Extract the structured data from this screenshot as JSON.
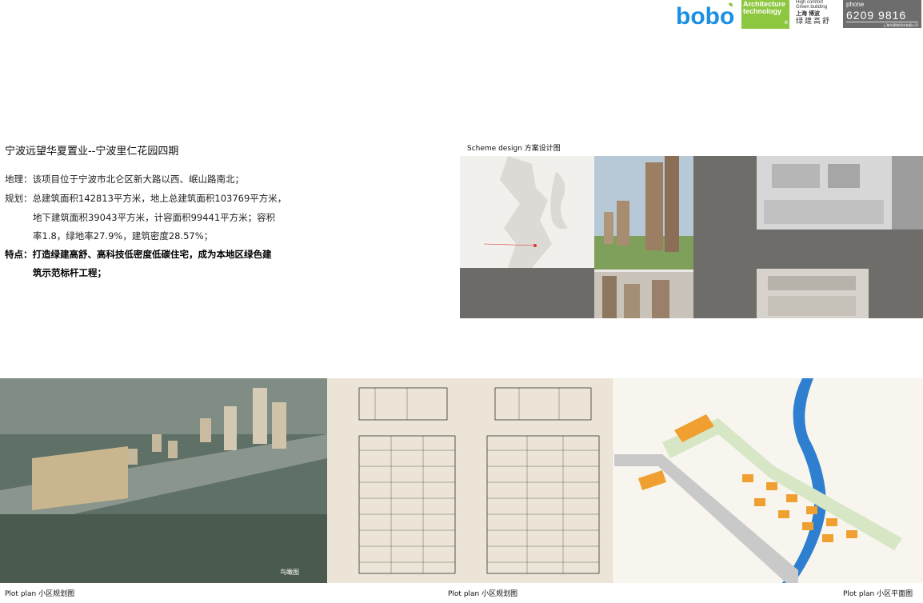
{
  "header": {
    "logo_text": "bobo",
    "arch_line1": "Architecture",
    "arch_line2": "technology",
    "arch_reg": "®",
    "brand_line1": "High comfort",
    "brand_line2": "Green building",
    "brand_cn1": "上海 博波",
    "brand_cn2": "绿建高舒",
    "phone_label": "phone",
    "phone_number": "6209 9816",
    "phone_sub": "上海市建筑科技有限公司"
  },
  "project": {
    "title": "宁波远望华夏置业--宁波里仁花园四期",
    "lines": [
      "地理：该项目位于宁波市北仑区新大路以西、岷山路南北；",
      "规划：总建筑面积142813平方米，地上总建筑面积103769平方米，",
      "地下建筑面积39043平方米，计容面积99441平方米；容积",
      "率1.8，绿地率27.9%，建筑密度28.57%；",
      "特点：打造绿建高舒、高科技低密度低碳住宅，成为本地区绿色建",
      "筑示范标杆工程；"
    ]
  },
  "scheme": {
    "label": "Scheme design  方案设计图"
  },
  "images": {
    "aerial_label": "鸟瞰图"
  },
  "captions": {
    "left": "Plot plan  小区规划图",
    "center": "Plot plan  小区规划图",
    "right": "Plot plan  小区平面图"
  },
  "colors": {
    "brand_blue": "#1a8fe3",
    "brand_green": "#8dc63f",
    "phone_bg": "#6d6d6d",
    "building_orange": "#f0a030",
    "river_blue": "#2f7fd0",
    "drawing_paper": "#ece4d6"
  }
}
